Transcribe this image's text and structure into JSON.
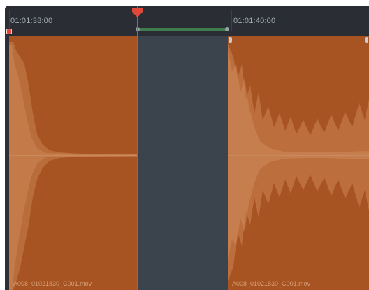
{
  "timeline": {
    "ruler": {
      "timecode_left": "01:01:38:00",
      "timecode_right": "01:01:40:00"
    },
    "clips": [
      {
        "name": "A008_01021830_C001.mov"
      },
      {
        "name": "A008_01021830_C001.mov"
      }
    ],
    "colors": {
      "clip": "#a75422",
      "waveform": "#c9814e",
      "gap": "#3b444c",
      "playhead": "#e0493a",
      "range": "#3f7e4c"
    }
  }
}
